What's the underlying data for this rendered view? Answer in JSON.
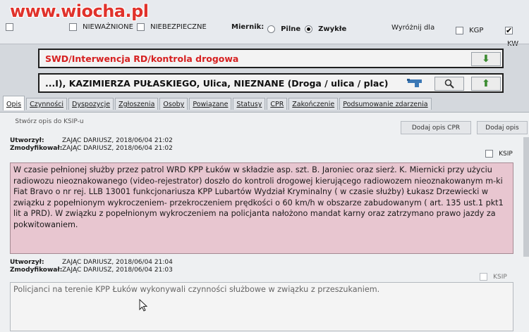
{
  "watermark": "www.wiocha.pl",
  "filters": {
    "items": [
      {
        "label": "",
        "checked": false
      },
      {
        "label": "NIEWAŻNIONE",
        "checked": false
      },
      {
        "label": "NIEBEZPIECZNE",
        "checked": false
      }
    ],
    "miernik_label": "Miernik:",
    "radio_pilne": "Pilne",
    "radio_zwykle": "Zwykłe",
    "wyroznij_label": "Wyróżnij dla",
    "kgp_label": "KGP",
    "kw_label": "KW"
  },
  "fields": {
    "category": "SWD/Interwencja RD/kontrola drogowa",
    "address": "...I), KAZIMIERZA PUŁASKIEGO, Ulica, NIEZNANE  (Droga / ulica / plac)"
  },
  "tabs": [
    "Opis",
    "Czynności",
    "Dyspozycje",
    "Zgłoszenia",
    "Osoby",
    "Powiązane",
    "Statusy",
    "CPR",
    "Zakończenie",
    "Podsumowanie zdarzenia"
  ],
  "toolbar": {
    "create_ksip": "Stwórz opis do KSIP-u",
    "add_cpr": "Dodaj opis CPR",
    "add_desc": "Dodaj opis"
  },
  "notes": [
    {
      "created_label": "Utworzył:",
      "created_value": "ZAJĄC DARIUSZ, 2018/06/04 21:02",
      "modified_label": "Zmodyfikował:",
      "modified_value": "ZAJĄC DARIUSZ, 2018/06/04 21:02",
      "ksip_label": "KSIP",
      "text": "W czasie pełnionej służby przez patrol WRD KPP Łuków w składzie asp. szt. B. Jaroniec oraz sierż. K. Miernicki przy użyciu radiowozu nieoznakowanego (video-rejestrator) doszło do kontroli drogowej kierującego radiowozem nieoznakowanym m-ki Fiat Bravo o nr rej. LLB 13001 funkcjonariusza KPP Lubartów Wydział Kryminalny ( w czasie służby) Łukasz Drzewiecki w związku z popełnionym wykroczeniem- przekroczeniem prędkości o 60 km/h w obszarze zabudowanym ( art. 135 ust.1 pkt1 lit a PRD). W związku z popełnionym wykroczeniem na policjanta nałożono mandat karny oraz zatrzymano prawo jazdy za pokwitowaniem."
    },
    {
      "created_label": "Utworzył:",
      "created_value": "ZAJĄC DARIUSZ, 2018/06/04 21:04",
      "modified_label": "Zmodyfikował:",
      "modified_value": "ZAJĄC DARIUSZ, 2018/06/04 21:03",
      "ksip_label": "KSIP",
      "text": "Policjanci na terenie KPP Łuków wykonywali czynności służbowe w związku z przeszukaniem."
    }
  ],
  "colors": {
    "note_pink": "#e8c6d0",
    "watermark_red": "#e0322b",
    "category_red": "#d62020"
  }
}
